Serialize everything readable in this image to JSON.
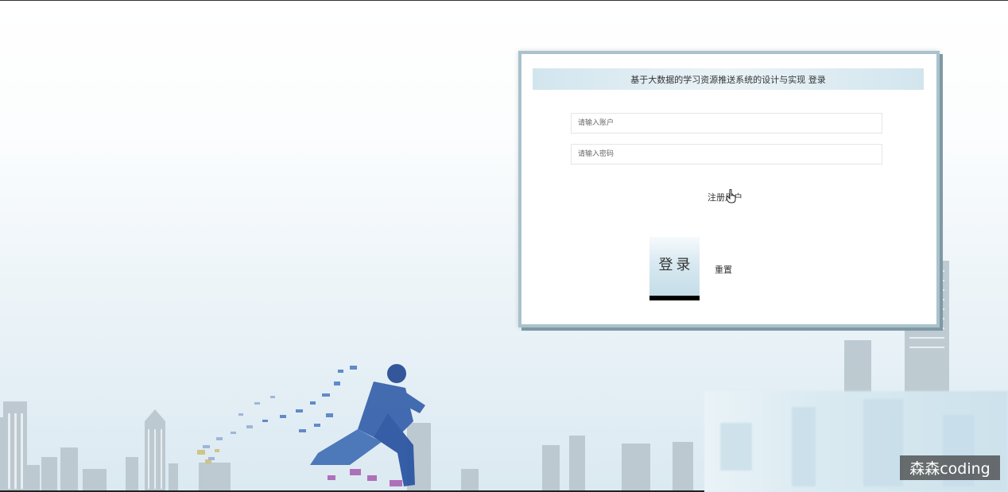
{
  "login": {
    "title": "基于大数据的学习资源推送系统的设计与实现 登录",
    "username_placeholder": "请输入账户",
    "password_placeholder": "请输入密码",
    "register_link": "注册用户",
    "login_button": "登录",
    "reset_button": "重置"
  },
  "watermark": "森森coding",
  "colors": {
    "card_border": "#a9c2cc",
    "title_bar": "#d2e5ee",
    "login_button": "#c5dde8"
  },
  "icons": [
    "hand-pointer-cursor-icon"
  ]
}
